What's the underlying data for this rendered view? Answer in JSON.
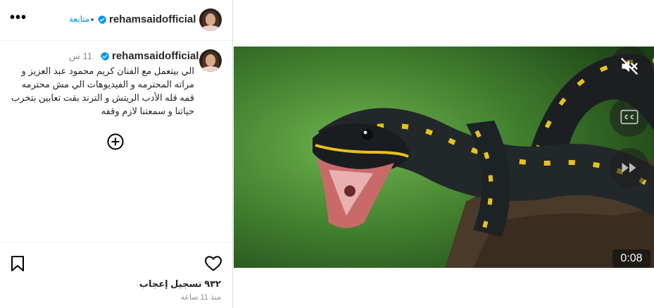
{
  "header": {
    "username": "rehamsaidofficial",
    "follow_label": "متابعة",
    "separator": "•"
  },
  "caption": {
    "username": "rehamsaidofficial",
    "time_ago": "11 س",
    "text": "الي بيتعمل مع الفنان كريم محمود عبد العزيز و مراته المحترمه و الفيديوهات الي مش محترمه قمه قله الأدب الريتش و الترند بقت تعابين بتخرب حياتنا و سمعتنا لازم وقفه"
  },
  "actions": {
    "likes_text": "٩٣٢ تسجيل إعجاب",
    "timestamp": "منذ 11 ساعة"
  },
  "video": {
    "duration": "0:08",
    "controls": [
      "unmute-icon",
      "captions-icon",
      "fast-forward-icon"
    ]
  },
  "colors": {
    "verified": "#0095f6",
    "link": "#0095f6",
    "muted_text": "#8e8e8e"
  }
}
